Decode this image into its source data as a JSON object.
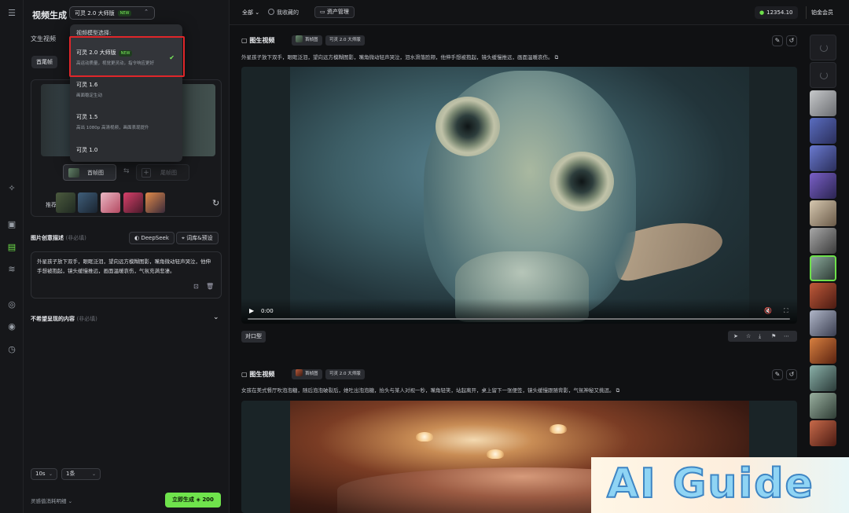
{
  "app": {
    "panel_title": "视频生成",
    "model_button": "可灵 2.0 大师版",
    "model_badge": "NEW",
    "mode_tab": "文生视频",
    "frame_tab": "首尾帧"
  },
  "upload": {
    "first_frame": "首帧图",
    "last_frame": "尾帧图",
    "recommend_label": "推荐"
  },
  "description": {
    "label": "图片创意描述",
    "hint": "(非必填)",
    "deepseek": "DeepSeek",
    "library": "词库&预设",
    "text": "外星孩子放下双手，眼眶泛泪，望向远方模糊图影，嘴角微动轻声哭泣，他伸手想被抱起，镜头缓慢推远，画面温暖哀伤，气氛充满悲凄。"
  },
  "negative": {
    "label": "不希望呈现的内容",
    "hint": "(非必填)"
  },
  "settings": {
    "duration": "10s",
    "count": "1条"
  },
  "footer": {
    "cost_label": "灵感值消耗明细",
    "generate": "立即生成",
    "generate_cost": "200"
  },
  "dropdown": {
    "header": "视频模型选择:",
    "items": [
      {
        "name": "可灵 2.0 大师版",
        "badge": "NEW",
        "desc": "高运动质量，视觉更灵动，指令响应更好",
        "selected": true
      },
      {
        "name": "可灵 1.6",
        "desc": "画面稳定生动"
      },
      {
        "name": "可灵 1.5",
        "desc": "高出 1080p 高清视频，画面表现提升"
      },
      {
        "name": "可灵 1.0",
        "desc": ""
      }
    ]
  },
  "topbar": {
    "filter": "全部",
    "favorites": "我收藏的",
    "assets": "资产管理",
    "credits": "12354.10",
    "member": "铂金会员"
  },
  "cards": [
    {
      "type": "图生视频",
      "frame_chip": "首帧图",
      "model_chip": "可灵 2.0 大师版",
      "desc": "外星孩子放下双手，眼眶泛泪，望向远方模糊图影，嘴角微动轻声哭泣，泪水滑落脸颊，他伸手想被抱起，镜头缓慢推远，画面温暖哀伤。",
      "time": "0:00",
      "lip_sync": "对口型"
    },
    {
      "type": "图生视频",
      "frame_chip": "首帧图",
      "model_chip": "可灵 2.0 大师版",
      "desc": "女孩在美式餐厅吹泡泡糖，随后泡泡破裂后，她吐出泡泡糖，抬头与某人对视一秒，嘴角轻笑，站起离开，桌上留下一张便签，镜头缓慢跟随背影，气氛神秘又挑逗。"
    }
  ],
  "watermark": {
    "text": "AI Guide"
  },
  "colors": {
    "accent": "#6ee04a",
    "highlight": "#e0262a"
  }
}
